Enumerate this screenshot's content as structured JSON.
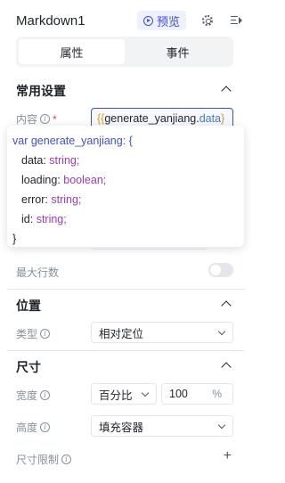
{
  "header": {
    "title": "Markdown1",
    "preview_label": "预览"
  },
  "tabs": [
    {
      "label": "属性",
      "active": true
    },
    {
      "label": "事件",
      "active": false
    }
  ],
  "sections": {
    "common": {
      "title": "常用设置",
      "content_label": "内容",
      "required_mark": "*",
      "content_value": {
        "open": "{{",
        "expr": "generate_yanjiang.",
        "prop": "data",
        "close": "}"
      },
      "max_rows_label": "最大行数",
      "max_rows_toggle_on": false
    },
    "position": {
      "title": "位置",
      "type_label": "类型",
      "type_value": "相对定位"
    },
    "size": {
      "title": "尺寸",
      "width_label": "宽度",
      "width_unit_select": "百分比",
      "width_value": "100",
      "width_unit": "%",
      "height_label": "高度",
      "height_value": "填充容器",
      "size_limit_label": "尺寸限制",
      "add_symbol": "+"
    }
  },
  "tooltip": {
    "var_kw": "var",
    "var_name": " generate_yanjiang: {",
    "fields": [
      {
        "name": "data:",
        "type": "string;"
      },
      {
        "name": "loading:",
        "type": "boolean;"
      },
      {
        "name": "error:",
        "type": "string;"
      },
      {
        "name": "id:",
        "type": "string;"
      }
    ],
    "close": "}"
  },
  "colors": {
    "accent": "#3c4fe0",
    "required": "#f53f3f",
    "type_color": "#a039b8"
  }
}
